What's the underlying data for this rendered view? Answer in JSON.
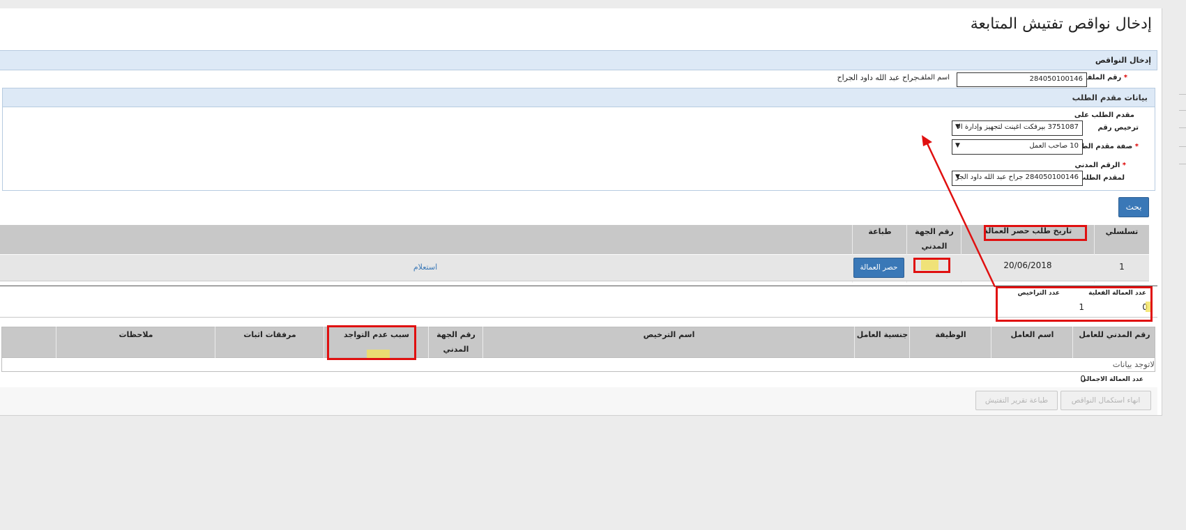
{
  "page": {
    "title": "إدخال نواقص تفتيش المتابعة"
  },
  "section": {
    "title": "إدخال النواقص"
  },
  "file": {
    "label": "رقم الملف",
    "value": "284050100146",
    "name_label": "اسم الملف",
    "name_value": "جراح عبد الله داود الجراح"
  },
  "applicant": {
    "title": "بيانات مقدم الطلب",
    "license_label_1": "مقدم الطلب على",
    "license_label_2": "ترخيص رقم",
    "license_value": "3751087 بيرفكت اغينت لتجهيز وإدارة الا",
    "role_label": "صفة مقدم الطلب",
    "role_value": "10 صاحب العمل",
    "civil_label_1": "الرقم المدني",
    "civil_label_2": "لمقدم الطلب",
    "civil_value": "284050100146 جراح عبد الله داود الجر"
  },
  "search_button": "بحث",
  "requests_table": {
    "headers": {
      "serial": "تسلسلي",
      "date": "تاريخ طلب حصر العمالة",
      "civil_1": "رقم الجهة",
      "civil_2": "المدني",
      "print": "طباعة"
    },
    "rows": [
      {
        "serial": "1",
        "date": "20/06/2018",
        "print_button": "حصر العمالة",
        "inquiry_link": "استعلام"
      }
    ]
  },
  "counts": {
    "actual_label": "عدد العمالة الفعلية",
    "actual_value": "0",
    "licenses_label": "عدد التراخيص",
    "licenses_value": "1"
  },
  "workers_table": {
    "headers": {
      "civil_id": "رقم المدني للعامل",
      "name": "اسم العامل",
      "job": "الوظيفة",
      "nationality": "جنسية العامل",
      "license_name": "اسم الترخيص",
      "entity_1": "رقم الجهة",
      "entity_2": "المدني",
      "absence_reason": "سبب عدم التواجد",
      "attachments": "مرفقات اثبات",
      "notes": "ملاحظات"
    },
    "empty": "لاتوجد بيانات"
  },
  "total": {
    "label": "عدد العمالة الاجمالي",
    "value": "0"
  },
  "footer_buttons": {
    "finish": "انهاء استكمال النواقص",
    "print": "طباعة تقرير التفتيش"
  },
  "annotation_color": "#e01010",
  "highlight_color": "#f2e15c",
  "accent_color": "#3a78b7"
}
